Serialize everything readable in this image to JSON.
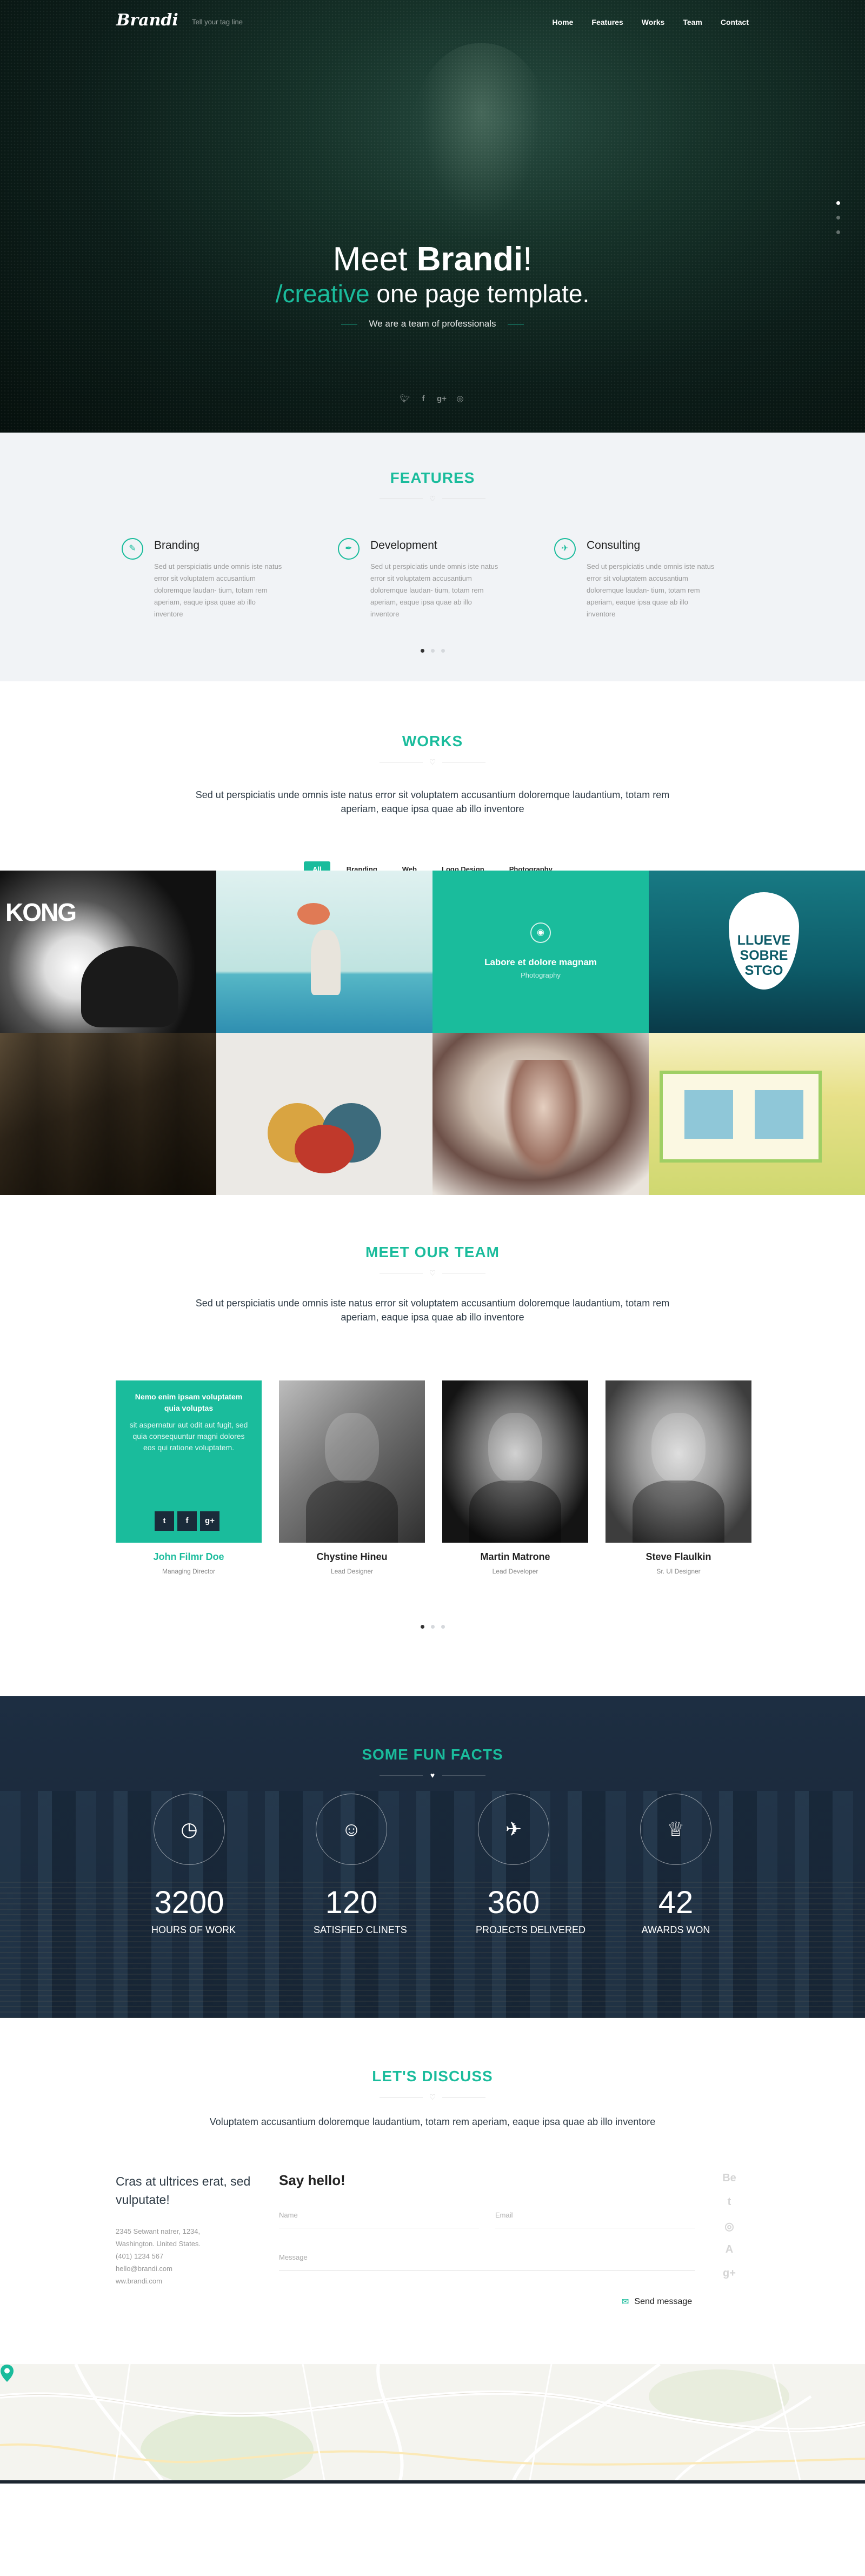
{
  "nav": {
    "logo": "Brandi",
    "tagline": "Tell your tag line",
    "items": [
      "Home",
      "Features",
      "Works",
      "Team",
      "Contact"
    ]
  },
  "hero": {
    "line1_pre": "Meet ",
    "line1_bold": "Brandi",
    "line1_post": "!",
    "line2_accent": "/creative",
    "line2_rest": " one page template.",
    "subline": "We are a team of professionals",
    "social_icons": [
      "twitter-icon",
      "facebook-icon",
      "google-plus-icon",
      "dribbble-icon"
    ]
  },
  "features": {
    "title": "FEATURES",
    "items": [
      {
        "icon": "brush-icon",
        "title": "Branding",
        "text": "Sed ut perspiciatis unde omnis iste natus error sit voluptatem accusantium doloremque laudan- tium, totam rem aperiam, eaque ipsa quae ab illo inventore"
      },
      {
        "icon": "pen-icon",
        "title": "Development",
        "text": "Sed ut perspiciatis unde omnis iste natus error sit voluptatem accusantium doloremque laudan- tium, totam rem aperiam, eaque ipsa quae ab illo inventore"
      },
      {
        "icon": "rocket-icon",
        "title": "Consulting",
        "text": "Sed ut perspiciatis unde omnis iste natus error sit voluptatem accusantium doloremque laudan- tium, totam rem aperiam, eaque ipsa quae ab illo inventore"
      }
    ]
  },
  "works": {
    "title": "WORKS",
    "lead": "Sed ut perspiciatis unde omnis iste natus error sit voluptatem accusantium doloremque laudantium, totam rem aperiam, eaque ipsa quae ab illo inventore",
    "filters": [
      "All",
      "Branding",
      "Web",
      "Logo Design",
      "Photography"
    ],
    "kong": "KONG",
    "drop_text": "LLUEVE SOBRE STGO",
    "hover_title": "Labore et dolore magnam",
    "hover_category": "Photography"
  },
  "team": {
    "title": "MEET OUR TEAM",
    "lead": "Sed ut perspiciatis unde omnis iste natus error sit voluptatem accusantium doloremque laudantium, totam rem aperiam, eaque ipsa quae ab illo inventore",
    "hover_title": "Nemo enim ipsam voluptatem quia voluptas",
    "hover_text": "sit aspernatur aut odit aut fugit, sed quia consequuntur magni dolores eos qui ratione voluptatem.",
    "hover_social": [
      "t",
      "f",
      "g+"
    ],
    "members": [
      {
        "name": "John Filmr Doe",
        "role": "Managing Director"
      },
      {
        "name": "Chystine Hineu",
        "role": "Lead Designer"
      },
      {
        "name": "Martin Matrone",
        "role": "Lead Developer"
      },
      {
        "name": "Steve Flaulkin",
        "role": "Sr. UI Designer"
      }
    ]
  },
  "facts": {
    "title": "SOME FUN FACTS",
    "items": [
      {
        "icon": "clock-icon",
        "number": "3200",
        "label": "HOURS OF WORK"
      },
      {
        "icon": "users-icon",
        "number": "120",
        "label": "SATISFIED CLINETS"
      },
      {
        "icon": "rocket-icon",
        "number": "360",
        "label": "PROJECTS DELIVERED"
      },
      {
        "icon": "trophy-icon",
        "number": "42",
        "label": "AWARDS WON"
      }
    ]
  },
  "contact": {
    "title": "LET'S DISCUSS",
    "lead": "Voluptatem accusantium doloremque laudantium, totam rem aperiam, eaque ipsa quae ab illo inventore",
    "left_heading": "Cras at ultrices erat, sed vulputate!",
    "address": [
      "2345 Setwant natrer, 1234,",
      "Washington. United States.",
      "(401) 1234 567",
      "hello@brandi.com",
      "ww.brandi.com"
    ],
    "form_title": "Say hello!",
    "name_placeholder": "Name",
    "email_placeholder": "Email",
    "message_placeholder": "Message",
    "send_label": "Send message",
    "social": [
      "Be",
      "t",
      "◎",
      "A",
      "g+"
    ]
  },
  "colors": {
    "accent": "#1abc9c",
    "dark": "#1b2530"
  }
}
